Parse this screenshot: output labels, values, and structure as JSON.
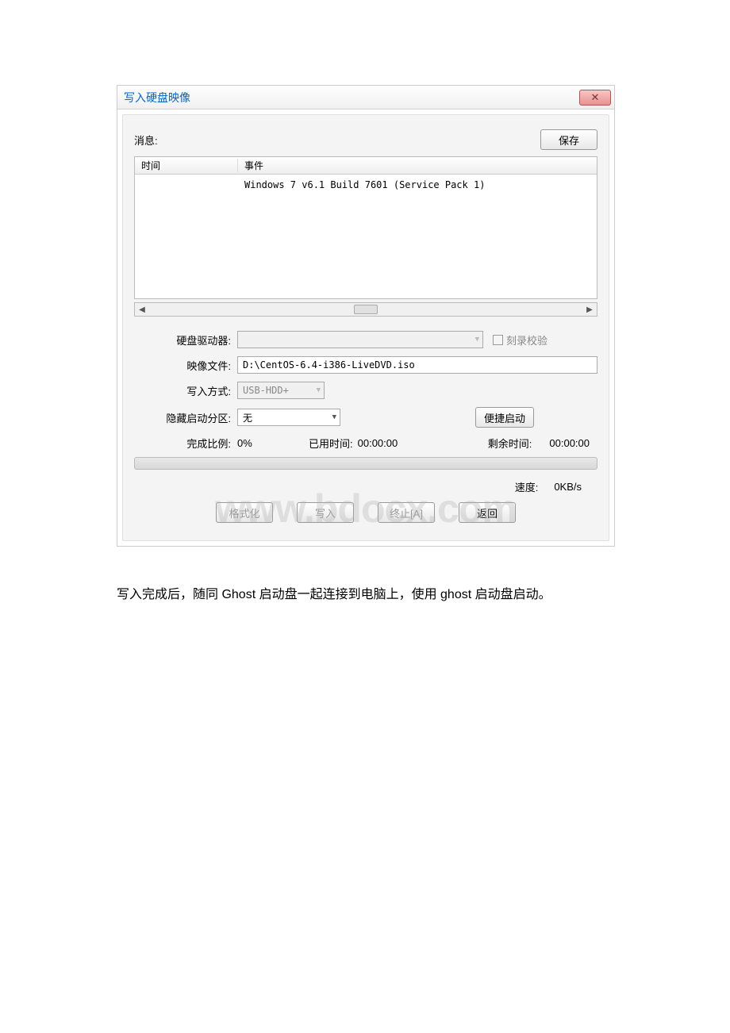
{
  "dialog": {
    "title": "写入硬盘映像",
    "close_icon": "✕"
  },
  "message": {
    "label": "消息:",
    "save_button": "保存"
  },
  "log": {
    "headers": {
      "time": "时间",
      "event": "事件"
    },
    "rows": [
      {
        "time": "",
        "event": "Windows 7 v6.1 Build 7601 (Service Pack 1)"
      }
    ]
  },
  "scroll": {
    "left": "◀",
    "right": "▶"
  },
  "form": {
    "drive_label": "硬盘驱动器:",
    "drive_value": "",
    "verify_label": "刻录校验",
    "image_label": "映像文件:",
    "image_value": "D:\\CentOS-6.4-i386-LiveDVD.iso",
    "write_mode_label": "写入方式:",
    "write_mode_value": "USB-HDD+",
    "hidden_boot_label": "隐藏启动分区:",
    "hidden_boot_value": "无",
    "convenient_boot": "便捷启动"
  },
  "progress": {
    "percent_label": "完成比例:",
    "percent_value": "0%",
    "elapsed_label": "已用时间:",
    "elapsed_value": "00:00:00",
    "remaining_label": "剩余时间:",
    "remaining_value": "00:00:00",
    "speed_label": "速度:",
    "speed_value": "0KB/s"
  },
  "buttons": {
    "format": "格式化",
    "write": "写入",
    "abort": "终止[A]",
    "return": "返回"
  },
  "watermark": "www.bdocx.com",
  "caption": "写入完成后，随同 Ghost 启动盘一起连接到电脑上，使用 ghost 启动盘启动。"
}
